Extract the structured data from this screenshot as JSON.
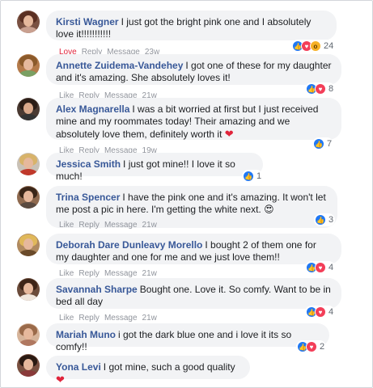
{
  "colors": {
    "author": "#385898",
    "bubble": "#f2f3f5",
    "like": "#2078f4",
    "love": "#f33e58",
    "wow": "#f7b125",
    "heart": "#e0243b"
  },
  "comments": [
    {
      "author": "Kirsti Wagner",
      "text": "I just got the bright pink one and I absolutely love it!!!!!!!!!!!",
      "actions": [
        "Love",
        "Reply",
        "Message",
        "23w"
      ],
      "reactions": [
        "like-icon",
        "love-icon",
        "wow-icon"
      ],
      "count": "24"
    },
    {
      "author": "Annette Zuidema-Vandehey",
      "text": "I got one of these for my daughter and it's amazing. She absolutely loves it!",
      "actions": [
        "Like",
        "Reply",
        "Message",
        "21w"
      ],
      "reactions": [
        "like-icon",
        "love-icon"
      ],
      "count": "8"
    },
    {
      "author": "Alex Magnarella",
      "text": "I was a bit worried at first but I just received mine and my roommates today! Their amazing and we absolutely love them, definitely worth it",
      "emoji": "❤",
      "actions": [
        "Like",
        "Reply",
        "Message",
        "19w"
      ],
      "reactions": [
        "like-icon"
      ],
      "count": "7"
    },
    {
      "author": "Jessica Smith",
      "text": "I just got mine!! I love it so much!",
      "actions": [
        "Like",
        "Reply",
        "Message",
        "19w"
      ],
      "reactions": [
        "like-icon"
      ],
      "count": "1"
    },
    {
      "author": "Trina Spencer",
      "text": "I have the pink one and it's amazing. It won't let me post a pic in here. I'm getting the white next.",
      "emoji": "😍",
      "actions": [
        "Like",
        "Reply",
        "Message",
        "21w"
      ],
      "reactions": [
        "like-icon"
      ],
      "count": "3"
    },
    {
      "author": "Deborah Dare Dunleavy Morello",
      "text": "I bought 2 of them one for my daughter and one for me and we just love them!!",
      "actions": [
        "Like",
        "Reply",
        "Message",
        "21w"
      ],
      "reactions": [
        "like-icon",
        "love-icon"
      ],
      "count": "4"
    },
    {
      "author": "Savannah Sharpe",
      "text": "Bought one. Love it. So comfy. Want to be in bed all day",
      "actions": [
        "Like",
        "Reply",
        "Message",
        "21w"
      ],
      "reactions": [
        "like-icon",
        "love-icon"
      ],
      "count": "4"
    },
    {
      "author": "Mariah Muno",
      "text": "i got the dark blue one and i love it its so comfy!!",
      "actions": [
        "Like",
        "Reply",
        "Message",
        "21w"
      ],
      "reactions": [
        "like-icon",
        "love-icon"
      ],
      "count": "2"
    },
    {
      "author": "Yona Levi",
      "text": "I got mine, such a good quality",
      "emoji": "❤",
      "actions": [],
      "reactions": [],
      "count": ""
    }
  ]
}
